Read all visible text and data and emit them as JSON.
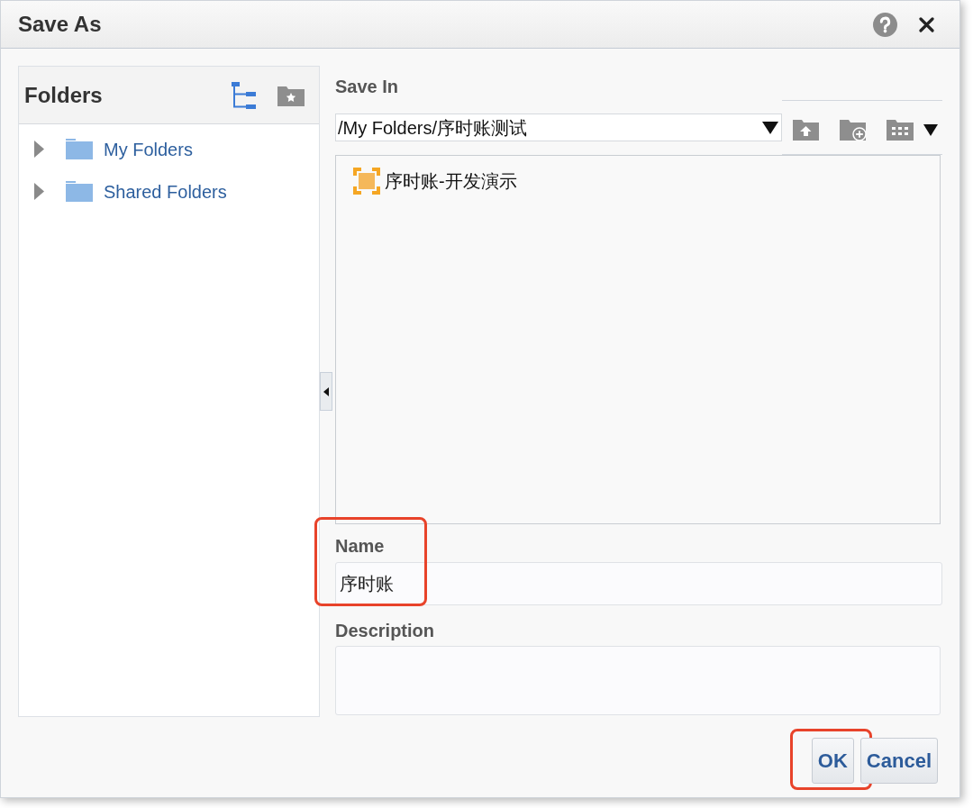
{
  "window": {
    "title": "Save As"
  },
  "folders_panel": {
    "title": "Folders",
    "items": [
      {
        "label": "My Folders",
        "expanded": false
      },
      {
        "label": "Shared Folders",
        "expanded": false
      }
    ]
  },
  "save_in": {
    "label": "Save In",
    "path": "/My Folders/序时账测试"
  },
  "files": [
    {
      "name": "序时账-开发演示"
    }
  ],
  "name_field": {
    "label": "Name",
    "value": "序时账",
    "highlighted": true
  },
  "description_field": {
    "label": "Description"
  },
  "buttons": [
    {
      "label": "OK",
      "highlighted": true
    },
    {
      "label": "Cancel",
      "highlighted": false
    }
  ]
}
